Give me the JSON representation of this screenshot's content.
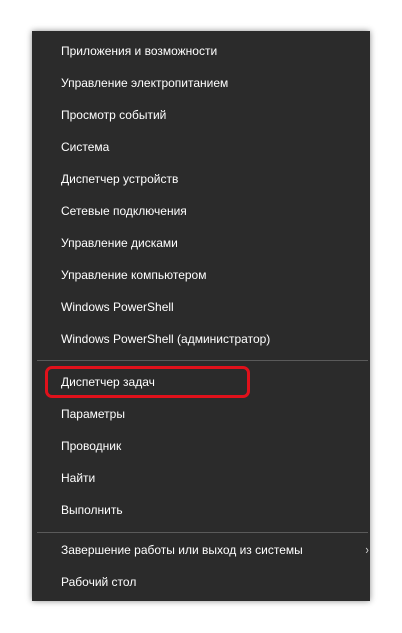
{
  "menu": {
    "group1": [
      "Приложения и возможности",
      "Управление электропитанием",
      "Просмотр событий",
      "Система",
      "Диспетчер устройств",
      "Сетевые подключения",
      "Управление дисками",
      "Управление компьютером",
      "Windows PowerShell",
      "Windows PowerShell (администратор)"
    ],
    "group2": [
      "Диспетчер задач",
      "Параметры",
      "Проводник",
      "Найти",
      "Выполнить"
    ],
    "group3": [
      "Завершение работы или выход из системы",
      "Рабочий стол"
    ],
    "submenu_indicator": "›"
  },
  "colors": {
    "menu_background": "#2b2b2b",
    "text": "#ffffff",
    "highlight_border": "#e0111b"
  },
  "highlighted_item": "Диспетчер задач"
}
